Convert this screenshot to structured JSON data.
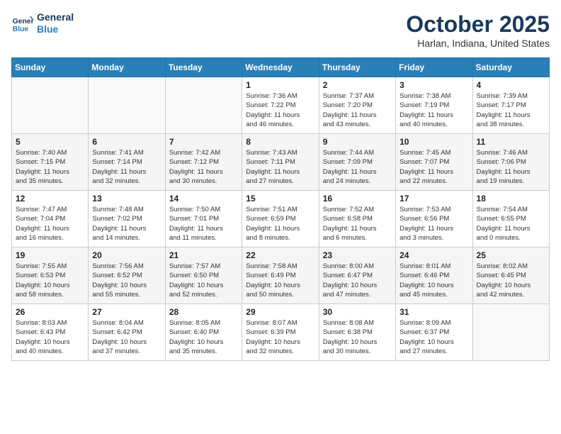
{
  "header": {
    "logo_line1": "General",
    "logo_line2": "Blue",
    "month": "October 2025",
    "location": "Harlan, Indiana, United States"
  },
  "days_of_week": [
    "Sunday",
    "Monday",
    "Tuesday",
    "Wednesday",
    "Thursday",
    "Friday",
    "Saturday"
  ],
  "weeks": [
    [
      {
        "day": "",
        "info": ""
      },
      {
        "day": "",
        "info": ""
      },
      {
        "day": "",
        "info": ""
      },
      {
        "day": "1",
        "info": "Sunrise: 7:36 AM\nSunset: 7:22 PM\nDaylight: 11 hours\nand 46 minutes."
      },
      {
        "day": "2",
        "info": "Sunrise: 7:37 AM\nSunset: 7:20 PM\nDaylight: 11 hours\nand 43 minutes."
      },
      {
        "day": "3",
        "info": "Sunrise: 7:38 AM\nSunset: 7:19 PM\nDaylight: 11 hours\nand 40 minutes."
      },
      {
        "day": "4",
        "info": "Sunrise: 7:39 AM\nSunset: 7:17 PM\nDaylight: 11 hours\nand 38 minutes."
      }
    ],
    [
      {
        "day": "5",
        "info": "Sunrise: 7:40 AM\nSunset: 7:15 PM\nDaylight: 11 hours\nand 35 minutes."
      },
      {
        "day": "6",
        "info": "Sunrise: 7:41 AM\nSunset: 7:14 PM\nDaylight: 11 hours\nand 32 minutes."
      },
      {
        "day": "7",
        "info": "Sunrise: 7:42 AM\nSunset: 7:12 PM\nDaylight: 11 hours\nand 30 minutes."
      },
      {
        "day": "8",
        "info": "Sunrise: 7:43 AM\nSunset: 7:11 PM\nDaylight: 11 hours\nand 27 minutes."
      },
      {
        "day": "9",
        "info": "Sunrise: 7:44 AM\nSunset: 7:09 PM\nDaylight: 11 hours\nand 24 minutes."
      },
      {
        "day": "10",
        "info": "Sunrise: 7:45 AM\nSunset: 7:07 PM\nDaylight: 11 hours\nand 22 minutes."
      },
      {
        "day": "11",
        "info": "Sunrise: 7:46 AM\nSunset: 7:06 PM\nDaylight: 11 hours\nand 19 minutes."
      }
    ],
    [
      {
        "day": "12",
        "info": "Sunrise: 7:47 AM\nSunset: 7:04 PM\nDaylight: 11 hours\nand 16 minutes."
      },
      {
        "day": "13",
        "info": "Sunrise: 7:48 AM\nSunset: 7:02 PM\nDaylight: 11 hours\nand 14 minutes."
      },
      {
        "day": "14",
        "info": "Sunrise: 7:50 AM\nSunset: 7:01 PM\nDaylight: 11 hours\nand 11 minutes."
      },
      {
        "day": "15",
        "info": "Sunrise: 7:51 AM\nSunset: 6:59 PM\nDaylight: 11 hours\nand 8 minutes."
      },
      {
        "day": "16",
        "info": "Sunrise: 7:52 AM\nSunset: 6:58 PM\nDaylight: 11 hours\nand 6 minutes."
      },
      {
        "day": "17",
        "info": "Sunrise: 7:53 AM\nSunset: 6:56 PM\nDaylight: 11 hours\nand 3 minutes."
      },
      {
        "day": "18",
        "info": "Sunrise: 7:54 AM\nSunset: 6:55 PM\nDaylight: 11 hours\nand 0 minutes."
      }
    ],
    [
      {
        "day": "19",
        "info": "Sunrise: 7:55 AM\nSunset: 6:53 PM\nDaylight: 10 hours\nand 58 minutes."
      },
      {
        "day": "20",
        "info": "Sunrise: 7:56 AM\nSunset: 6:52 PM\nDaylight: 10 hours\nand 55 minutes."
      },
      {
        "day": "21",
        "info": "Sunrise: 7:57 AM\nSunset: 6:50 PM\nDaylight: 10 hours\nand 52 minutes."
      },
      {
        "day": "22",
        "info": "Sunrise: 7:58 AM\nSunset: 6:49 PM\nDaylight: 10 hours\nand 50 minutes."
      },
      {
        "day": "23",
        "info": "Sunrise: 8:00 AM\nSunset: 6:47 PM\nDaylight: 10 hours\nand 47 minutes."
      },
      {
        "day": "24",
        "info": "Sunrise: 8:01 AM\nSunset: 6:46 PM\nDaylight: 10 hours\nand 45 minutes."
      },
      {
        "day": "25",
        "info": "Sunrise: 8:02 AM\nSunset: 6:45 PM\nDaylight: 10 hours\nand 42 minutes."
      }
    ],
    [
      {
        "day": "26",
        "info": "Sunrise: 8:03 AM\nSunset: 6:43 PM\nDaylight: 10 hours\nand 40 minutes."
      },
      {
        "day": "27",
        "info": "Sunrise: 8:04 AM\nSunset: 6:42 PM\nDaylight: 10 hours\nand 37 minutes."
      },
      {
        "day": "28",
        "info": "Sunrise: 8:05 AM\nSunset: 6:40 PM\nDaylight: 10 hours\nand 35 minutes."
      },
      {
        "day": "29",
        "info": "Sunrise: 8:07 AM\nSunset: 6:39 PM\nDaylight: 10 hours\nand 32 minutes."
      },
      {
        "day": "30",
        "info": "Sunrise: 8:08 AM\nSunset: 6:38 PM\nDaylight: 10 hours\nand 30 minutes."
      },
      {
        "day": "31",
        "info": "Sunrise: 8:09 AM\nSunset: 6:37 PM\nDaylight: 10 hours\nand 27 minutes."
      },
      {
        "day": "",
        "info": ""
      }
    ]
  ]
}
